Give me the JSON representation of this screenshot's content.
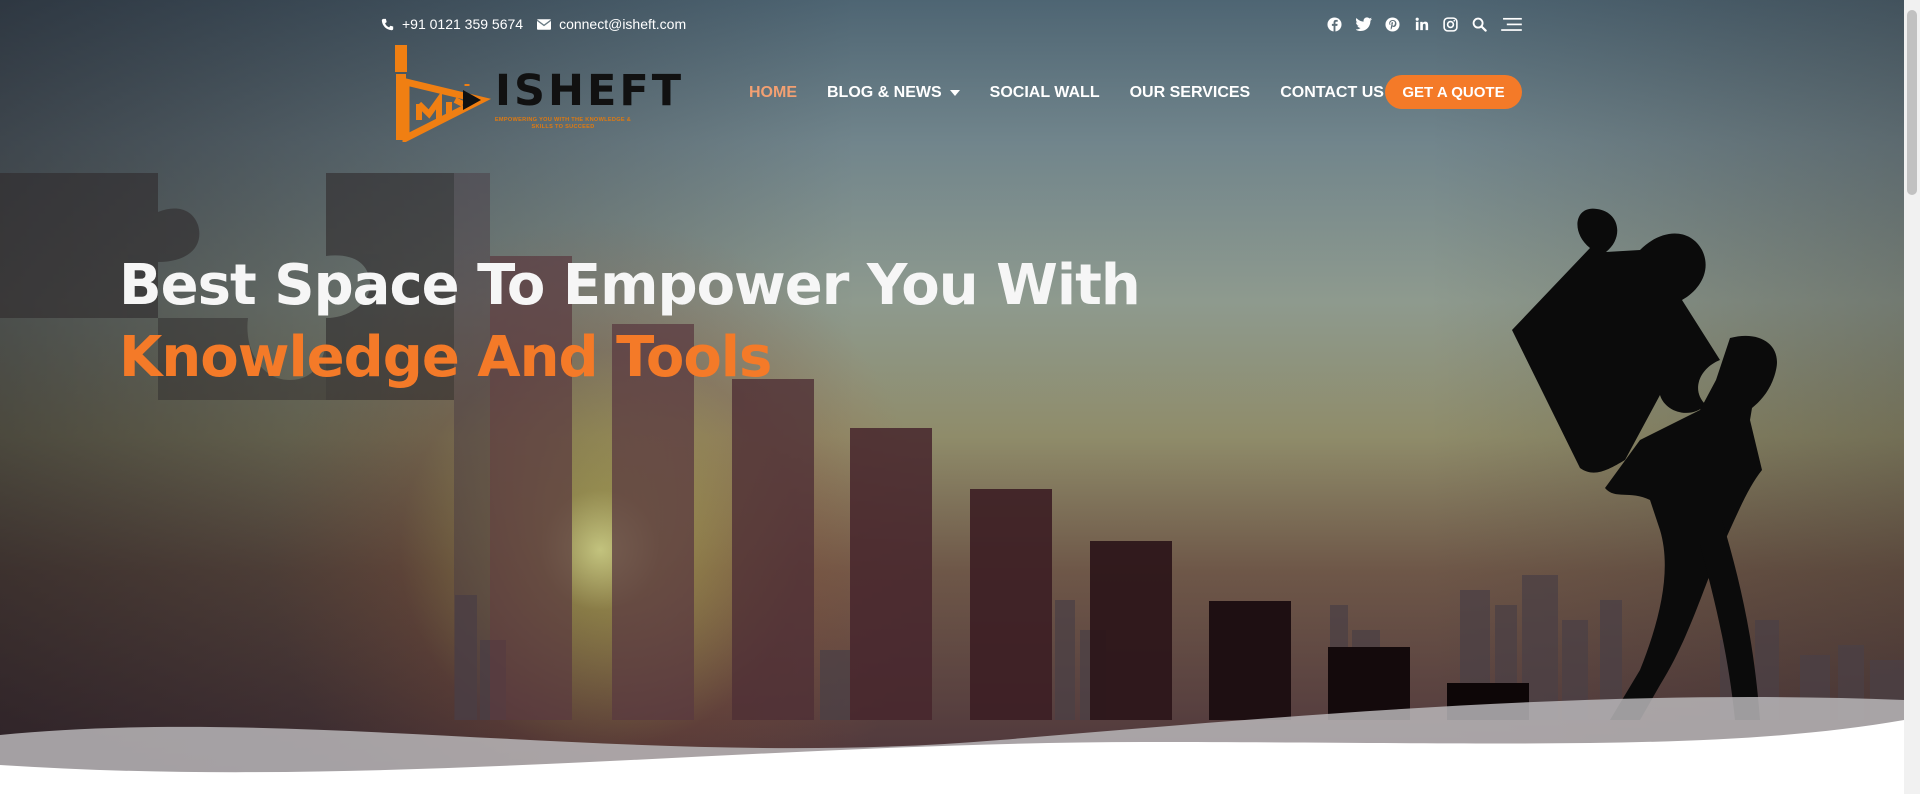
{
  "topbar": {
    "phone": "+91 0121 359 5674",
    "email": "connect@isheft.com",
    "icons": [
      "phone-icon",
      "envelope-icon",
      "facebook-icon",
      "twitter-icon",
      "pinterest-icon",
      "linkedin-icon",
      "instagram-icon",
      "search-icon",
      "menu-icon"
    ]
  },
  "logo": {
    "title": "ISHEFT",
    "tagline": "EMPOWERING YOU WITH THE KNOWLEDGE & SKILLS TO SUCCEED"
  },
  "nav": {
    "items": [
      {
        "label": "HOME"
      },
      {
        "label": "BLOG & NEWS"
      },
      {
        "label": "SOCIAL WALL"
      },
      {
        "label": "OUR SERVICES"
      },
      {
        "label": "CONTACT US"
      }
    ],
    "active": "HOME",
    "cta": "GET A QUOTE"
  },
  "hero": {
    "line1": "Best Space To Empower You With",
    "line2": "Knowledge And Tools"
  },
  "colors": {
    "accent": "#f47a28",
    "active_nav": "#f3a072",
    "logo_orange": "#e07a10",
    "text_white": "#ffffff"
  }
}
